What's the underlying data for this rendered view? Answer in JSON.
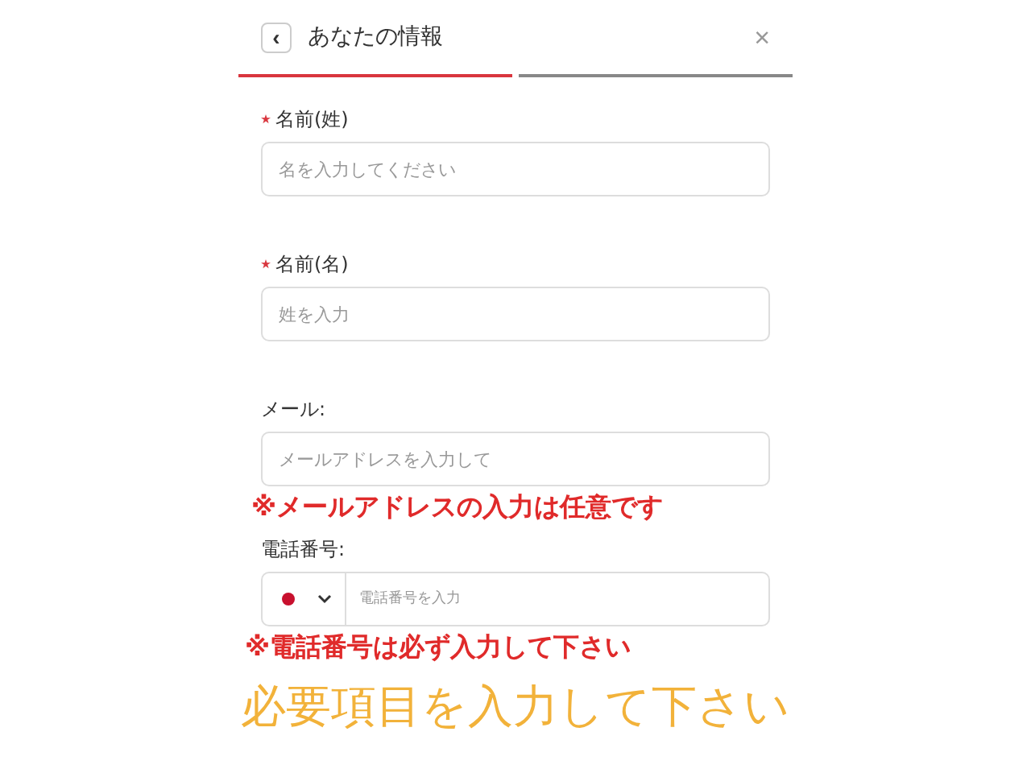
{
  "header": {
    "title": "あなたの情報",
    "back": "‹",
    "close": "×"
  },
  "steps": [
    {
      "selected": true
    },
    {
      "selected": false
    }
  ],
  "fields": [
    {
      "kind": "text",
      "label": "名前(姓)",
      "required": true,
      "placeholder": "名を入力してください"
    },
    {
      "kind": "text",
      "label": "名前(名)",
      "required": true,
      "placeholder": "姓を入力"
    },
    {
      "kind": "text",
      "label": "メール:",
      "required": false,
      "placeholder": "メールアドレスを入力して",
      "note": "※メールアドレスの入力は任意です"
    },
    {
      "kind": "phone",
      "label": "電話番号:",
      "required": false,
      "placeholder": "電話番号を入力",
      "note": "※電話番号は必ず入力して下さい"
    }
  ],
  "caption": "必要項目を入力して下さい"
}
